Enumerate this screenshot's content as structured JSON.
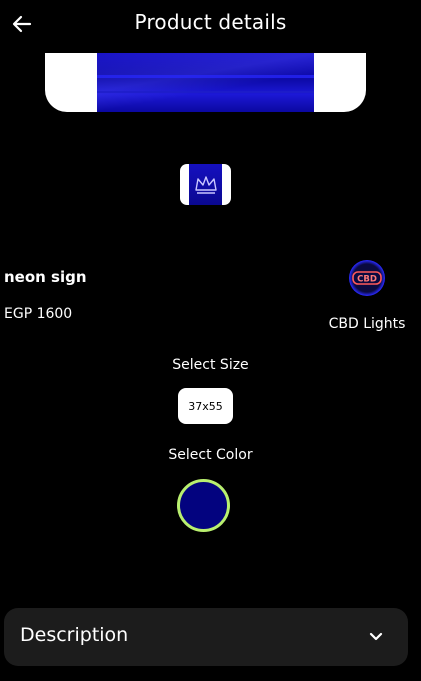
{
  "header": {
    "title": "Product details",
    "back_icon": "arrow-left-icon"
  },
  "product": {
    "name": "neon sign",
    "price": "EGP 1600",
    "brand": "CBD Lights",
    "brand_logo_text": "CBD"
  },
  "size": {
    "label": "Select Size",
    "options": [
      "37x55"
    ]
  },
  "color": {
    "label": "Select Color",
    "swatches": [
      {
        "color": "#03037f",
        "selected_ring": "#b9ef6f"
      }
    ]
  },
  "description": {
    "title": "Description",
    "icon": "chevron-down-icon"
  }
}
